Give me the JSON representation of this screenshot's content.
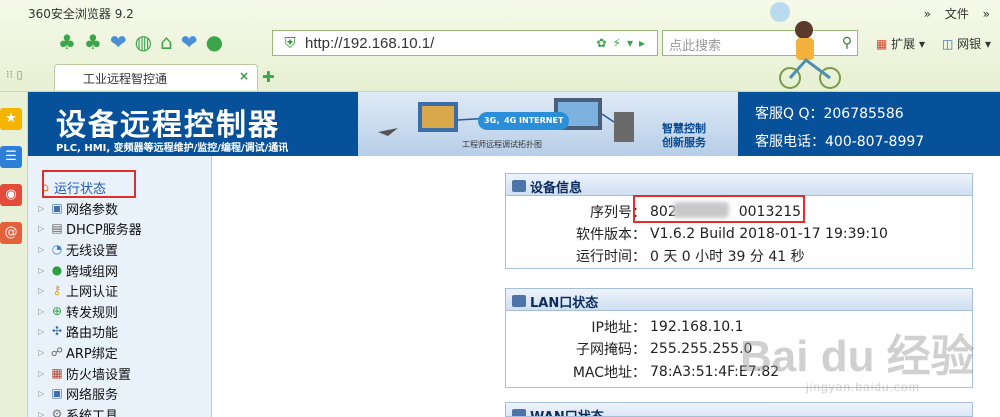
{
  "browser": {
    "title": "360安全浏览器 9.2",
    "menu": [
      "»",
      "文件",
      "»"
    ],
    "url": "http://192.168.10.1/",
    "search_placeholder": "点此搜索",
    "extensions_label": "扩展",
    "bank_label": "网银",
    "tab_title": "工业远程智控通"
  },
  "header": {
    "brand": "设备远程控制器",
    "subtitle": "PLC, HMI, 变频器等远程维护/监控/编程/调试/通讯",
    "banner_network": "3G，4G INTERNET",
    "banner_caption": "工程师远程调试拓扑图",
    "banner_smart_1": "智慧控制",
    "banner_smart_2": "创新服务",
    "qq": "客服Q Q：206785586",
    "phone": "客服电话：400-807-8997"
  },
  "sidebar": {
    "items": [
      {
        "label": "运行状态",
        "icon": "home-icon"
      },
      {
        "label": "网络参数",
        "icon": "monitor-icon"
      },
      {
        "label": "DHCP服务器",
        "icon": "server-icon"
      },
      {
        "label": "无线设置",
        "icon": "wifi-icon"
      },
      {
        "label": "跨域组网",
        "icon": "globe-icon"
      },
      {
        "label": "上网认证",
        "icon": "key-icon"
      },
      {
        "label": "转发规则",
        "icon": "forward-icon"
      },
      {
        "label": "路由功能",
        "icon": "route-icon"
      },
      {
        "label": "ARP绑定",
        "icon": "arp-icon"
      },
      {
        "label": "防火墙设置",
        "icon": "firewall-icon"
      },
      {
        "label": "网络服务",
        "icon": "service-icon"
      },
      {
        "label": "系统工具",
        "icon": "tools-icon"
      }
    ]
  },
  "device_info": {
    "title": "设备信息",
    "serial_label": "序列号：",
    "serial_value_a": "802",
    "serial_value_b": "0013215",
    "firmware_label": "软件版本：",
    "firmware_value": "V1.6.2 Build 2018-01-17 19:39:10",
    "uptime_label": "运行时间：",
    "uptime_value": "0 天 0 小时 39 分 41 秒"
  },
  "lan": {
    "title": "LAN口状态",
    "ip_label": "IP地址：",
    "ip_value": "192.168.10.1",
    "mask_label": "子网掩码：",
    "mask_value": "255.255.255.0",
    "mac_label": "MAC地址：",
    "mac_value": "78:A3:51:4F:E7:82"
  },
  "wan": {
    "title": "WAN口状态"
  },
  "watermark": {
    "text": "Bai du 经验",
    "url": "jingyan.baidu.com"
  }
}
